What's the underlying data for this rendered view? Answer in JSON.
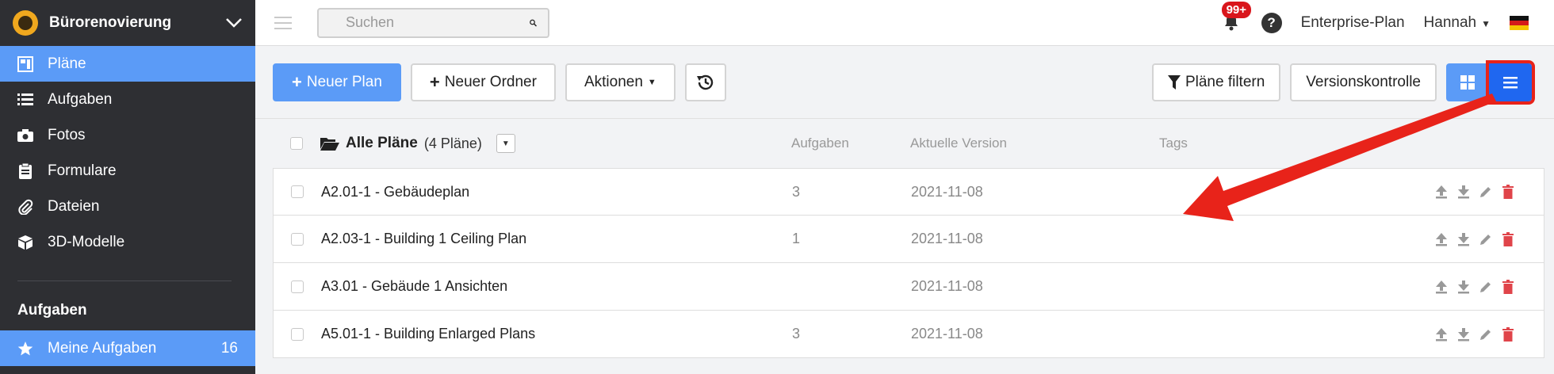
{
  "sidebar": {
    "project_name": "Bürorenovierung",
    "items": [
      {
        "label": "Pläne",
        "icon": "plans-icon",
        "active": true
      },
      {
        "label": "Aufgaben",
        "icon": "list-icon"
      },
      {
        "label": "Fotos",
        "icon": "camera-icon"
      },
      {
        "label": "Formulare",
        "icon": "clipboard-icon"
      },
      {
        "label": "Dateien",
        "icon": "paperclip-icon"
      },
      {
        "label": "3D-Modelle",
        "icon": "cube-icon"
      }
    ],
    "section_title": "Aufgaben",
    "my_tasks": {
      "label": "Meine Aufgaben",
      "count": "16",
      "icon": "star-icon"
    }
  },
  "topbar": {
    "search_placeholder": "Suchen",
    "notification_badge": "99+",
    "help": "?",
    "plan": "Enterprise-Plan",
    "user": "Hannah"
  },
  "toolbar": {
    "new_plan": "Neuer Plan",
    "new_folder": "Neuer Ordner",
    "actions": "Aktionen",
    "filter": "Pläne filtern",
    "version_control": "Versionskontrolle"
  },
  "table": {
    "folder_title": "Alle Pläne",
    "folder_count": "(4 Pläne)",
    "columns": {
      "tasks": "Aufgaben",
      "version": "Aktuelle Version",
      "tags": "Tags"
    },
    "rows": [
      {
        "name": "A2.01-1 - Gebäudeplan",
        "tasks": "3",
        "version": "2021-11-08",
        "tags": ""
      },
      {
        "name": "A2.03-1 - Building 1 Ceiling Plan",
        "tasks": "1",
        "version": "2021-11-08",
        "tags": ""
      },
      {
        "name": "A3.01 - Gebäude 1 Ansichten",
        "tasks": "",
        "version": "2021-11-08",
        "tags": ""
      },
      {
        "name": "A5.01-1 - Building Enlarged Plans",
        "tasks": "3",
        "version": "2021-11-08",
        "tags": ""
      }
    ]
  },
  "colors": {
    "accent": "#5b9bf7",
    "accent_dark": "#1f67f0",
    "sidebar_bg": "#2e2f33",
    "annotation_red": "#e8231a",
    "delete_red": "#e0444a"
  }
}
